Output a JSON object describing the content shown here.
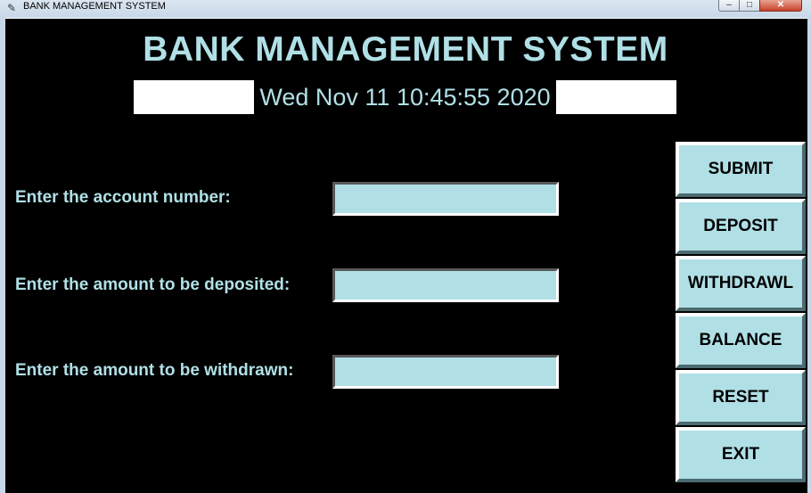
{
  "window": {
    "title": "BANK MANAGEMENT SYSTEM",
    "controls": {
      "minimize": "–",
      "maximize": "□",
      "close": "✕"
    }
  },
  "header": {
    "title": "BANK MANAGEMENT SYSTEM",
    "clock": "Wed Nov 11 10:45:55 2020"
  },
  "form": {
    "account_label": "Enter the account number:",
    "account_value": "",
    "deposit_label": "Enter the amount to be deposited:",
    "deposit_value": "",
    "withdraw_label": "Enter the amount to be withdrawn:",
    "withdraw_value": ""
  },
  "buttons": {
    "submit": "SUBMIT",
    "deposit": "DEPOSIT",
    "withdrawl": "WITHDRAWL",
    "balance": "BALANCE",
    "reset": "RESET",
    "exit": "EXIT"
  },
  "colors": {
    "background": "#000000",
    "accent": "#b0e0e6",
    "field": "#b0e0e6"
  }
}
